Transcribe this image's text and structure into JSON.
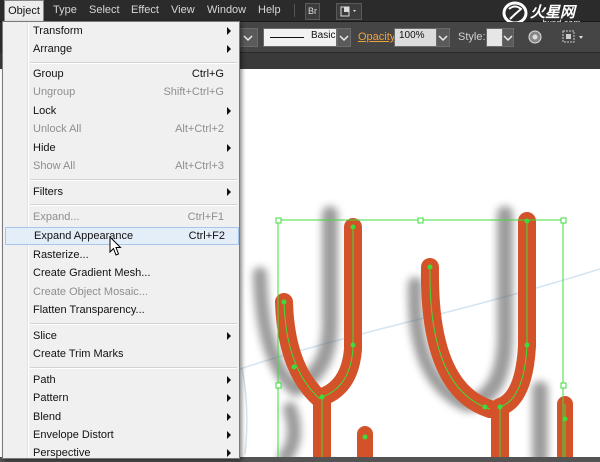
{
  "menubar": {
    "items": [
      "Object",
      "Type",
      "Select",
      "Effect",
      "View",
      "Window",
      "Help"
    ],
    "bridge_label": "Br"
  },
  "control_bar": {
    "stroke_style": "Basic",
    "opacity_label": "Opacity:",
    "opacity_value": "100%",
    "style_label": "Style:"
  },
  "object_menu": {
    "items": [
      {
        "label": "Transform",
        "shortcut": "",
        "submenu": true,
        "enabled": true
      },
      {
        "label": "Arrange",
        "shortcut": "",
        "submenu": true,
        "enabled": true
      },
      {
        "label": "Group",
        "shortcut": "Ctrl+G",
        "submenu": false,
        "enabled": true
      },
      {
        "label": "Ungroup",
        "shortcut": "Shift+Ctrl+G",
        "submenu": false,
        "enabled": false
      },
      {
        "label": "Lock",
        "shortcut": "",
        "submenu": true,
        "enabled": true
      },
      {
        "label": "Unlock All",
        "shortcut": "Alt+Ctrl+2",
        "submenu": false,
        "enabled": false
      },
      {
        "label": "Hide",
        "shortcut": "",
        "submenu": true,
        "enabled": true
      },
      {
        "label": "Show All",
        "shortcut": "Alt+Ctrl+3",
        "submenu": false,
        "enabled": false
      },
      {
        "label": "Filters",
        "shortcut": "",
        "submenu": true,
        "enabled": true
      },
      {
        "label": "Expand...",
        "shortcut": "Ctrl+F1",
        "submenu": false,
        "enabled": false
      },
      {
        "label": "Expand Appearance",
        "shortcut": "Ctrl+F2",
        "submenu": false,
        "enabled": true,
        "highlighted": true
      },
      {
        "label": "Rasterize...",
        "shortcut": "",
        "submenu": false,
        "enabled": true
      },
      {
        "label": "Create Gradient Mesh...",
        "shortcut": "",
        "submenu": false,
        "enabled": true
      },
      {
        "label": "Create Object Mosaic...",
        "shortcut": "",
        "submenu": false,
        "enabled": false
      },
      {
        "label": "Flatten Transparency...",
        "shortcut": "",
        "submenu": false,
        "enabled": true
      },
      {
        "label": "Slice",
        "shortcut": "",
        "submenu": true,
        "enabled": true
      },
      {
        "label": "Create Trim Marks",
        "shortcut": "",
        "submenu": false,
        "enabled": true
      },
      {
        "label": "Path",
        "shortcut": "",
        "submenu": true,
        "enabled": true
      },
      {
        "label": "Pattern",
        "shortcut": "",
        "submenu": true,
        "enabled": true
      },
      {
        "label": "Blend",
        "shortcut": "",
        "submenu": true,
        "enabled": true
      },
      {
        "label": "Envelope Distort",
        "shortcut": "",
        "submenu": true,
        "enabled": true
      },
      {
        "label": "Perspective",
        "shortcut": "",
        "submenu": true,
        "enabled": true
      }
    ]
  },
  "watermark": {
    "main": "火星网",
    "sub": "hxsd.com"
  },
  "colors": {
    "brand_orange": "#d4522a",
    "selection_green": "#3ddc3d",
    "menu_highlight": "#e4eef9",
    "opacity_orange": "#f0a23c"
  }
}
